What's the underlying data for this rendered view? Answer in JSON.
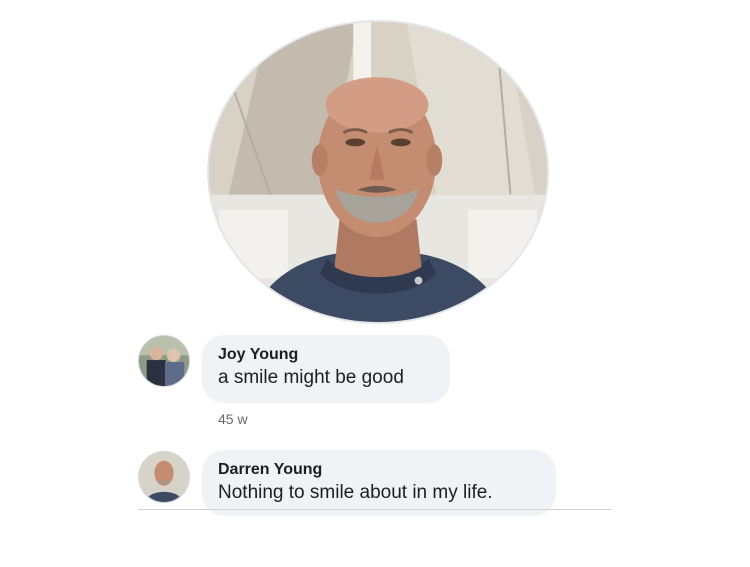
{
  "post": {
    "profile_photo_alt": "profile photo"
  },
  "comments": [
    {
      "author": "Joy Young",
      "text": "a smile might be good",
      "timestamp": "45 w"
    },
    {
      "author": "Darren Young",
      "text": "Nothing to smile about in my life."
    }
  ],
  "colors": {
    "bubble_bg": "#f0f2f5",
    "timestamp": "#65676b",
    "text": "#1c1e21"
  }
}
